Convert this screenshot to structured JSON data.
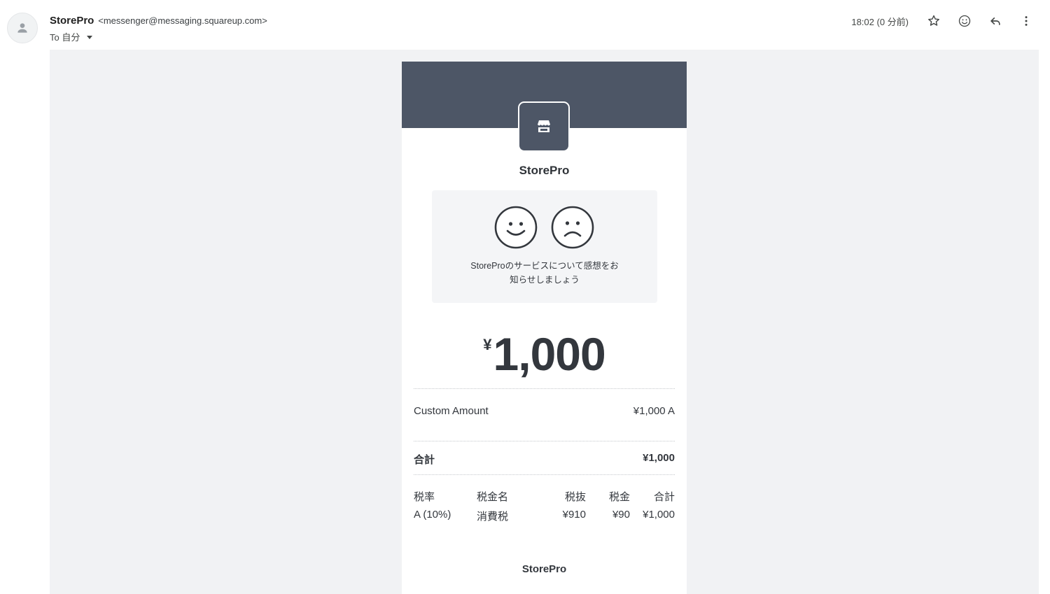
{
  "email": {
    "sender_name": "StorePro",
    "sender_email": "<messenger@messaging.squareup.com>",
    "to_label": "To 自分",
    "time": "18:02 (0 分前)"
  },
  "icons": [
    "person-icon",
    "dropdown-caret-icon",
    "star-icon",
    "emoji-icon",
    "reply-icon",
    "more-vert-icon",
    "store-icon",
    "happy-face-icon",
    "sad-face-icon"
  ],
  "colors": {
    "banner": "#4d5666",
    "canvas": "#f1f2f4",
    "feedback_bg": "#f4f5f7",
    "text": "#33373d"
  },
  "receipt": {
    "store_name": "StorePro",
    "feedback_prompt_line1": "StoreProのサービスについて感想をお",
    "feedback_prompt_line2": "知らせしましょう",
    "currency_symbol": "¥",
    "amount": "1,000",
    "item": {
      "name": "Custom Amount",
      "price": "¥1,000 A"
    },
    "total": {
      "label": "合計",
      "value": "¥1,000"
    },
    "tax_table": {
      "headers": [
        "税率",
        "税金名",
        "税抜",
        "税金",
        "合計"
      ],
      "row": [
        "A (10%)",
        "消費税",
        "¥910",
        "¥90",
        "¥1,000"
      ]
    },
    "footer_name": "StorePro"
  }
}
